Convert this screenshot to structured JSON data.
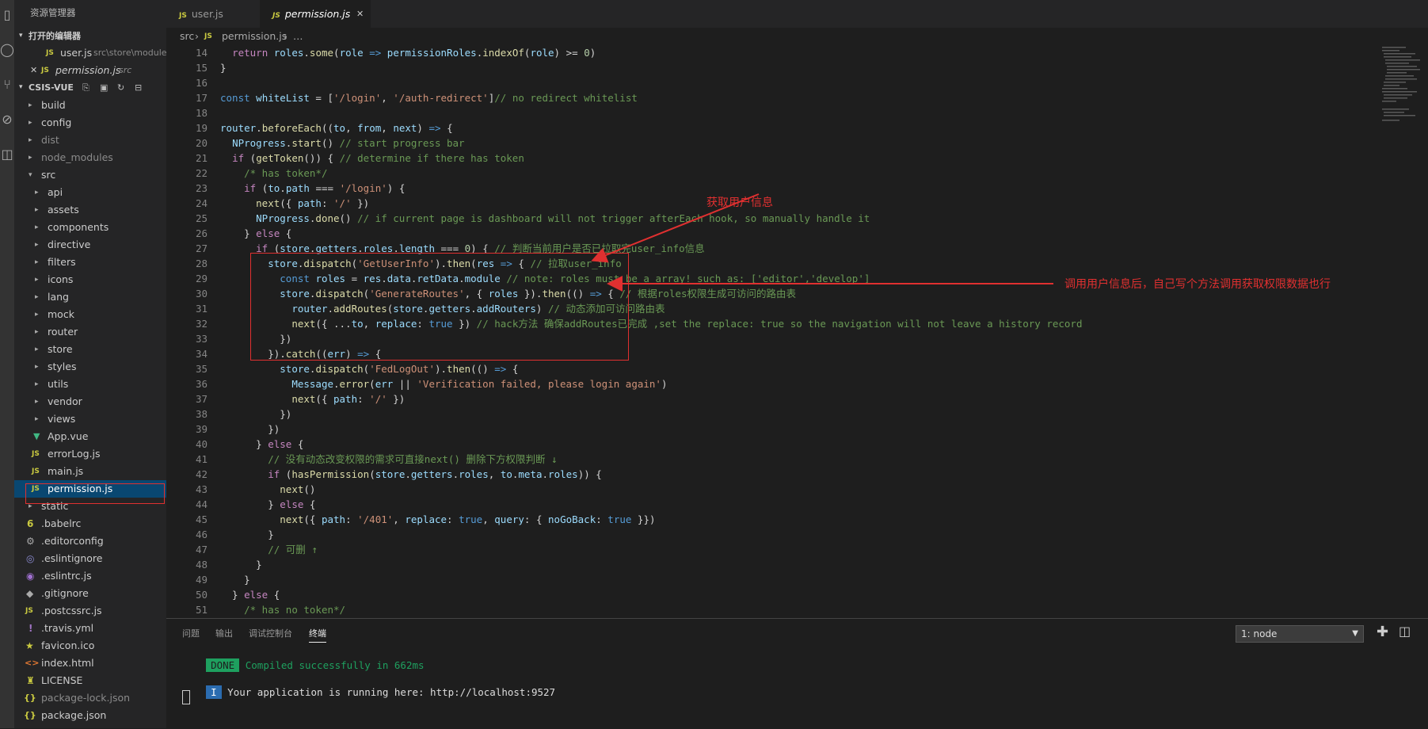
{
  "sidebar": {
    "title": "资源管理器",
    "open_editors_label": "打开的编辑器",
    "open_editors": [
      {
        "name": "user.js",
        "path": "src\\store\\modules"
      },
      {
        "name": "permission.js",
        "path": "src"
      }
    ],
    "project_label": "CSIS-VUE",
    "tree": [
      "build",
      "config",
      "dist",
      "node_modules",
      "src",
      "api",
      "assets",
      "components",
      "directive",
      "filters",
      "icons",
      "lang",
      "mock",
      "router",
      "store",
      "styles",
      "utils",
      "vendor",
      "views",
      "App.vue",
      "errorLog.js",
      "main.js",
      "permission.js",
      "static",
      ".babelrc",
      ".editorconfig",
      ".eslintignore",
      ".eslintrc.js",
      ".gitignore",
      ".postcssrc.js",
      ".travis.yml",
      "favicon.ico",
      "index.html",
      "LICENSE",
      "package-lock.json",
      "package.json"
    ]
  },
  "tabs": [
    {
      "label": "user.js"
    },
    {
      "label": "permission.js",
      "close": "✕"
    }
  ],
  "breadcrumb": {
    "root": "src",
    "sep": "›",
    "file": "permission.js",
    "tail": "…"
  },
  "line_numbers": [
    "14",
    "15",
    "16",
    "17",
    "18",
    "19",
    "20",
    "21",
    "22",
    "23",
    "24",
    "25",
    "26",
    "27",
    "28",
    "29",
    "30",
    "31",
    "32",
    "33",
    "34",
    "35",
    "36",
    "37",
    "38",
    "39",
    "40",
    "41",
    "42",
    "43",
    "44",
    "45",
    "46",
    "47",
    "48",
    "49",
    "50",
    "51"
  ],
  "annotations": {
    "label1": "获取用户信息",
    "label2": "调用用户信息后，自己写个方法调用获取权限数据也行"
  },
  "panel": {
    "tabs": [
      "问题",
      "输出",
      "调试控制台",
      "终端"
    ],
    "terminal_select": "1: node",
    "done_badge": "DONE",
    "line1": "Compiled successfully in 662ms",
    "info_badge": "I",
    "line2": "Your application is running here: http://localhost:9527"
  },
  "colors": {
    "accent": "#094771",
    "annotation": "#e03030",
    "done": "#1ea05f",
    "info": "#2b6cb0"
  }
}
